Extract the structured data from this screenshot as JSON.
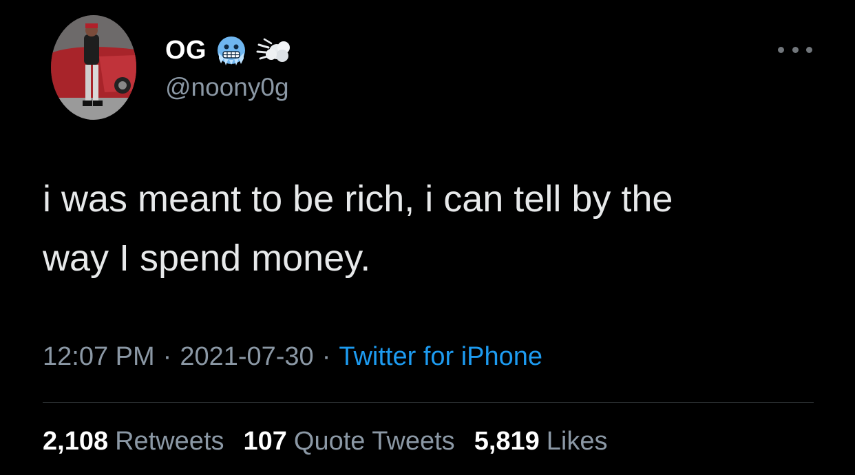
{
  "author": {
    "display_name": "OG",
    "handle": "@noony0g",
    "badges": [
      "cold-face-emoji",
      "dashing-away-emoji"
    ],
    "avatar_icon": "profile-photo-person-by-red-car"
  },
  "tweet": {
    "text_line1": "i was meant to be rich, i can tell by the",
    "text_line2": "way I spend money."
  },
  "meta": {
    "time": "12:07 PM",
    "separator": "·",
    "date": "2021-07-30",
    "source": "Twitter for iPhone"
  },
  "stats": {
    "retweets_count": "2,108",
    "retweets_label": "Retweets",
    "quotes_count": "107",
    "quotes_label": "Quote Tweets",
    "likes_count": "5,819",
    "likes_label": "Likes"
  },
  "colors": {
    "background": "#000000",
    "text": "#e7e9ea",
    "secondary": "#8b98a5",
    "link": "#1d9bf0",
    "divider": "#2f3336"
  }
}
